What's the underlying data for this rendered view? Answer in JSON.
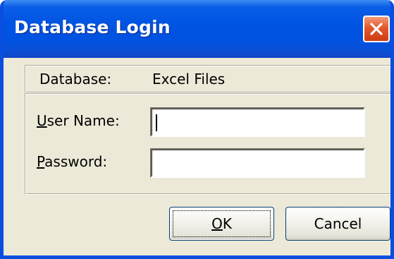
{
  "window": {
    "title": "Database Login",
    "close_icon": "close-x-icon",
    "colors": {
      "titlebar": "#0054e3",
      "close_button": "#e2582b",
      "dialog_background": "#ece9d8"
    }
  },
  "database": {
    "label": "Database:",
    "value": "Excel Files"
  },
  "credentials": {
    "username": {
      "label_accel": "U",
      "label_rest": "ser Name:",
      "value": ""
    },
    "password": {
      "label_accel": "P",
      "label_rest": "assword:",
      "value": ""
    }
  },
  "buttons": {
    "ok_accel": "O",
    "ok_rest": "K",
    "cancel": "Cancel"
  }
}
